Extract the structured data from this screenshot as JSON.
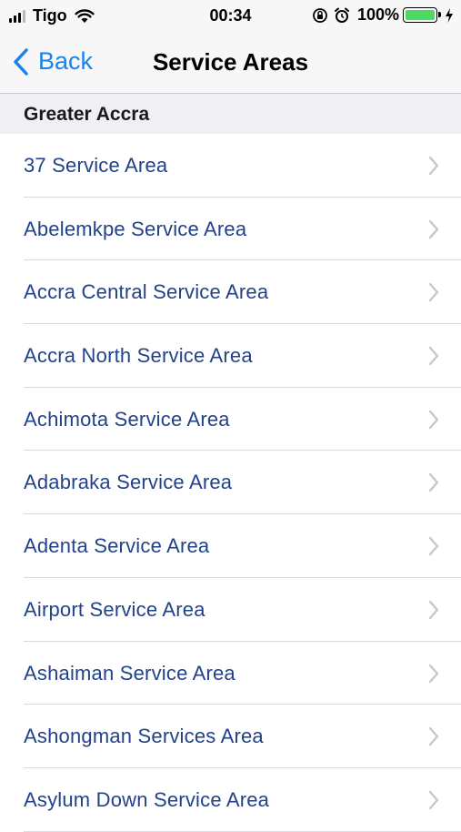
{
  "status_bar": {
    "carrier": "Tigo",
    "time": "00:34",
    "battery_percent": "100%",
    "battery_level": 1.0,
    "icons": [
      "signal-icon",
      "wifi-icon",
      "orientation-lock-icon",
      "alarm-icon",
      "battery-icon",
      "charging-bolt-icon"
    ]
  },
  "nav": {
    "back_label": "Back",
    "title": "Service Areas"
  },
  "section": {
    "header": "Greater Accra"
  },
  "items": [
    {
      "label": "37 Service Area"
    },
    {
      "label": "Abelemkpe Service Area"
    },
    {
      "label": "Accra Central Service Area"
    },
    {
      "label": "Accra North Service Area"
    },
    {
      "label": "Achimota Service Area"
    },
    {
      "label": "Adabraka Service Area"
    },
    {
      "label": "Adenta Service Area"
    },
    {
      "label": "Airport Service Area"
    },
    {
      "label": "Ashaiman Service Area"
    },
    {
      "label": "Ashongman Services Area"
    },
    {
      "label": "Asylum Down Service Area"
    }
  ],
  "colors": {
    "accent": "#1b82ec",
    "item_text": "#22428a",
    "section_bg": "#efeff4",
    "battery": "#4cd964"
  }
}
